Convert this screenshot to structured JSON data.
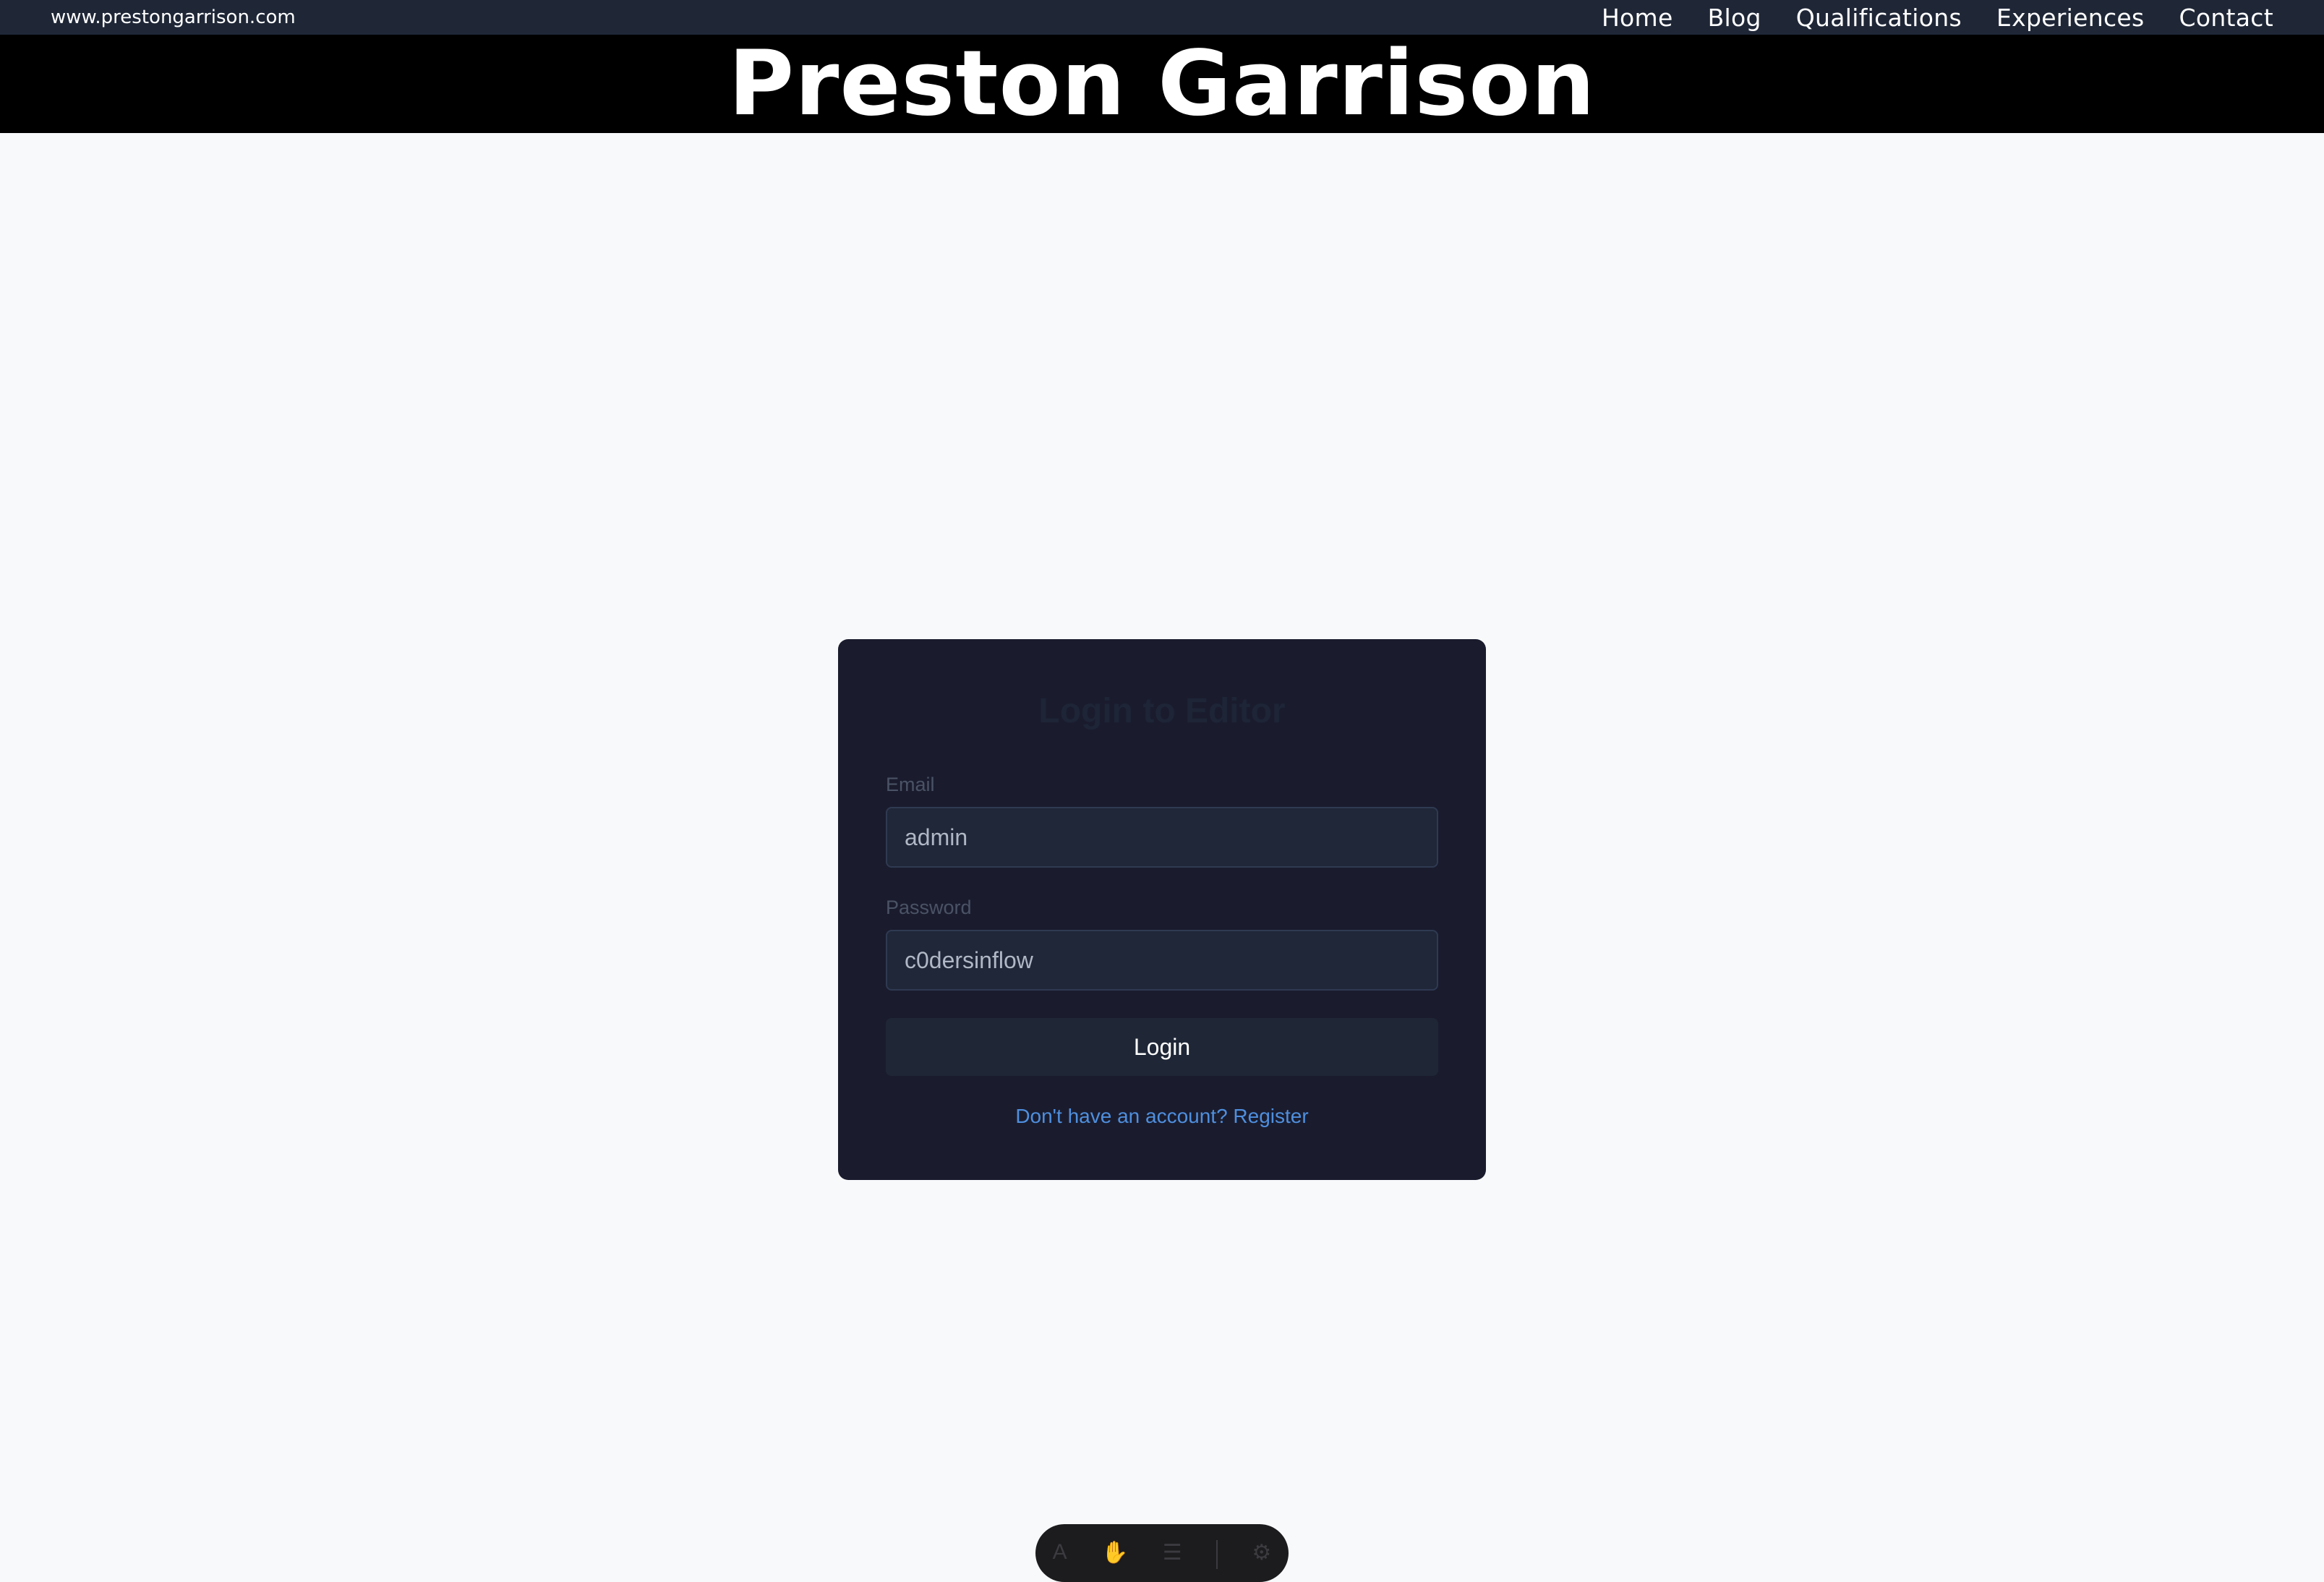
{
  "topbar": {
    "site_url": "www.prestongarrison.com",
    "nav": [
      "Home",
      "Blog",
      "Qualifications",
      "Experiences",
      "Contact"
    ]
  },
  "banner": {
    "title": "Preston Garrison"
  },
  "login": {
    "title": "Login to Editor",
    "email_label": "Email",
    "email_value": "admin",
    "password_label": "Password",
    "password_value": "c0dersinflow",
    "button": "Login",
    "register_text": "Don't have an account? Register"
  },
  "dock": {
    "icons": [
      "text-icon",
      "hand-icon",
      "menu-icon",
      "settings-icon"
    ]
  }
}
